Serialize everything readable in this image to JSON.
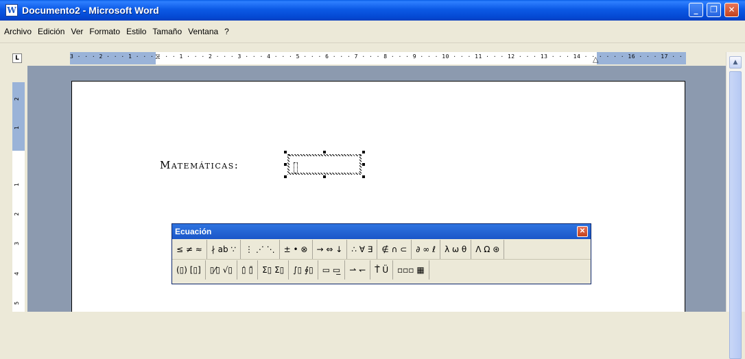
{
  "window": {
    "title": "Documento2 - Microsoft Word",
    "app_icon_glyph": "W",
    "buttons": {
      "minimize": "_",
      "restore": "❐",
      "close": "✕"
    }
  },
  "menu": [
    "Archivo",
    "Edición",
    "Ver",
    "Formato",
    "Estilo",
    "Tamaño",
    "Ventana",
    "?"
  ],
  "ruler": {
    "corner": "L",
    "labels": "3 · · · 2 · · · 1 · · ·   · · · 1 · · · 2 · · · 3 · · · 4 · · · 5 · · · 6 · · · 7 · · · 8 · · · 9 · · · 10 · · · 11 · · · 12 · · · 13 · · · 14 · · ·   · · · 16 · · · 17 · ·",
    "vertical_labels": [
      "2",
      "1",
      "1",
      "2",
      "3",
      "4",
      "5"
    ]
  },
  "document": {
    "label_big_m": "M",
    "label_small": "ATEMÁTICAS",
    "label_colon": ":"
  },
  "equation_toolbar": {
    "title": "Ecuación",
    "close": "✕",
    "row1": [
      "≤ ≠ ≈",
      "∤ ab ∵",
      "⋮ ⋰ ⋱",
      "± • ⊗",
      "→ ⇔ ↓",
      "∴ ∀ ∃",
      "∉ ∩ ⊂",
      "∂ ∞ ℓ",
      "λ ω θ",
      "Λ Ω ⊛"
    ],
    "row2": [
      "(▯) [▯]",
      "▯⁄▯ √▯",
      "▯̇ ▯̄",
      "Σ▯ Σ▯",
      "∫▯ ∮▯",
      "▭ ▭̲",
      "⇀ ↽",
      "Ṫ̄ Ü",
      "▫▫▫ ▦"
    ]
  }
}
